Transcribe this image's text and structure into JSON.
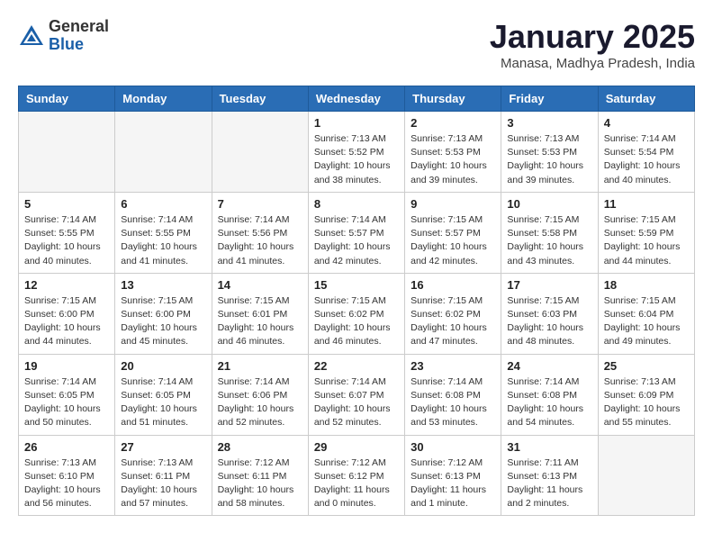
{
  "logo": {
    "general": "General",
    "blue": "Blue"
  },
  "header": {
    "month": "January 2025",
    "location": "Manasa, Madhya Pradesh, India"
  },
  "weekdays": [
    "Sunday",
    "Monday",
    "Tuesday",
    "Wednesday",
    "Thursday",
    "Friday",
    "Saturday"
  ],
  "weeks": [
    [
      {
        "day": "",
        "info": ""
      },
      {
        "day": "",
        "info": ""
      },
      {
        "day": "",
        "info": ""
      },
      {
        "day": "1",
        "info": "Sunrise: 7:13 AM\nSunset: 5:52 PM\nDaylight: 10 hours\nand 38 minutes."
      },
      {
        "day": "2",
        "info": "Sunrise: 7:13 AM\nSunset: 5:53 PM\nDaylight: 10 hours\nand 39 minutes."
      },
      {
        "day": "3",
        "info": "Sunrise: 7:13 AM\nSunset: 5:53 PM\nDaylight: 10 hours\nand 39 minutes."
      },
      {
        "day": "4",
        "info": "Sunrise: 7:14 AM\nSunset: 5:54 PM\nDaylight: 10 hours\nand 40 minutes."
      }
    ],
    [
      {
        "day": "5",
        "info": "Sunrise: 7:14 AM\nSunset: 5:55 PM\nDaylight: 10 hours\nand 40 minutes."
      },
      {
        "day": "6",
        "info": "Sunrise: 7:14 AM\nSunset: 5:55 PM\nDaylight: 10 hours\nand 41 minutes."
      },
      {
        "day": "7",
        "info": "Sunrise: 7:14 AM\nSunset: 5:56 PM\nDaylight: 10 hours\nand 41 minutes."
      },
      {
        "day": "8",
        "info": "Sunrise: 7:14 AM\nSunset: 5:57 PM\nDaylight: 10 hours\nand 42 minutes."
      },
      {
        "day": "9",
        "info": "Sunrise: 7:15 AM\nSunset: 5:57 PM\nDaylight: 10 hours\nand 42 minutes."
      },
      {
        "day": "10",
        "info": "Sunrise: 7:15 AM\nSunset: 5:58 PM\nDaylight: 10 hours\nand 43 minutes."
      },
      {
        "day": "11",
        "info": "Sunrise: 7:15 AM\nSunset: 5:59 PM\nDaylight: 10 hours\nand 44 minutes."
      }
    ],
    [
      {
        "day": "12",
        "info": "Sunrise: 7:15 AM\nSunset: 6:00 PM\nDaylight: 10 hours\nand 44 minutes."
      },
      {
        "day": "13",
        "info": "Sunrise: 7:15 AM\nSunset: 6:00 PM\nDaylight: 10 hours\nand 45 minutes."
      },
      {
        "day": "14",
        "info": "Sunrise: 7:15 AM\nSunset: 6:01 PM\nDaylight: 10 hours\nand 46 minutes."
      },
      {
        "day": "15",
        "info": "Sunrise: 7:15 AM\nSunset: 6:02 PM\nDaylight: 10 hours\nand 46 minutes."
      },
      {
        "day": "16",
        "info": "Sunrise: 7:15 AM\nSunset: 6:02 PM\nDaylight: 10 hours\nand 47 minutes."
      },
      {
        "day": "17",
        "info": "Sunrise: 7:15 AM\nSunset: 6:03 PM\nDaylight: 10 hours\nand 48 minutes."
      },
      {
        "day": "18",
        "info": "Sunrise: 7:15 AM\nSunset: 6:04 PM\nDaylight: 10 hours\nand 49 minutes."
      }
    ],
    [
      {
        "day": "19",
        "info": "Sunrise: 7:14 AM\nSunset: 6:05 PM\nDaylight: 10 hours\nand 50 minutes."
      },
      {
        "day": "20",
        "info": "Sunrise: 7:14 AM\nSunset: 6:05 PM\nDaylight: 10 hours\nand 51 minutes."
      },
      {
        "day": "21",
        "info": "Sunrise: 7:14 AM\nSunset: 6:06 PM\nDaylight: 10 hours\nand 52 minutes."
      },
      {
        "day": "22",
        "info": "Sunrise: 7:14 AM\nSunset: 6:07 PM\nDaylight: 10 hours\nand 52 minutes."
      },
      {
        "day": "23",
        "info": "Sunrise: 7:14 AM\nSunset: 6:08 PM\nDaylight: 10 hours\nand 53 minutes."
      },
      {
        "day": "24",
        "info": "Sunrise: 7:14 AM\nSunset: 6:08 PM\nDaylight: 10 hours\nand 54 minutes."
      },
      {
        "day": "25",
        "info": "Sunrise: 7:13 AM\nSunset: 6:09 PM\nDaylight: 10 hours\nand 55 minutes."
      }
    ],
    [
      {
        "day": "26",
        "info": "Sunrise: 7:13 AM\nSunset: 6:10 PM\nDaylight: 10 hours\nand 56 minutes."
      },
      {
        "day": "27",
        "info": "Sunrise: 7:13 AM\nSunset: 6:11 PM\nDaylight: 10 hours\nand 57 minutes."
      },
      {
        "day": "28",
        "info": "Sunrise: 7:12 AM\nSunset: 6:11 PM\nDaylight: 10 hours\nand 58 minutes."
      },
      {
        "day": "29",
        "info": "Sunrise: 7:12 AM\nSunset: 6:12 PM\nDaylight: 11 hours\nand 0 minutes."
      },
      {
        "day": "30",
        "info": "Sunrise: 7:12 AM\nSunset: 6:13 PM\nDaylight: 11 hours\nand 1 minute."
      },
      {
        "day": "31",
        "info": "Sunrise: 7:11 AM\nSunset: 6:13 PM\nDaylight: 11 hours\nand 2 minutes."
      },
      {
        "day": "",
        "info": ""
      }
    ]
  ]
}
